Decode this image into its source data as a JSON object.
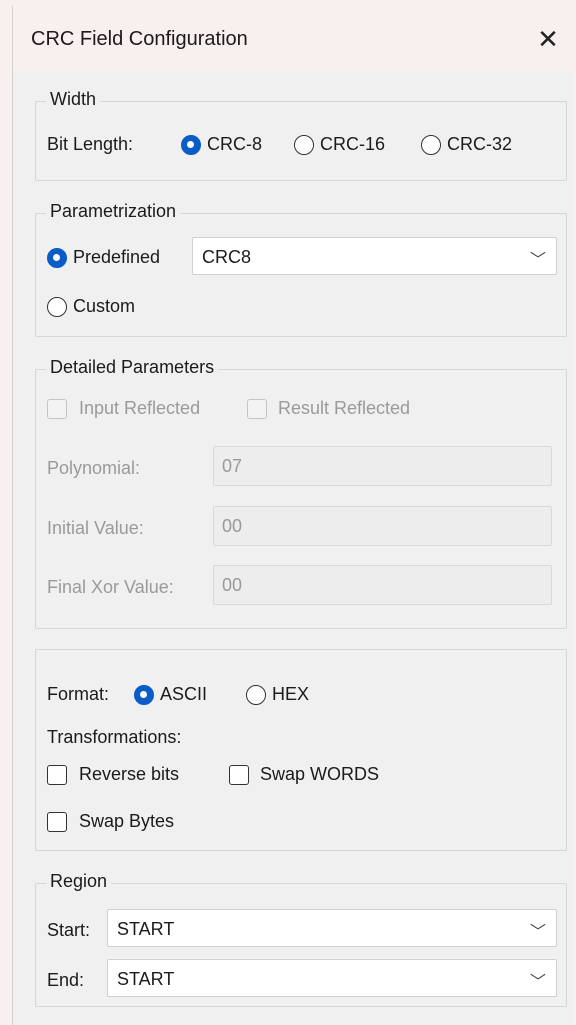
{
  "window": {
    "title": "CRC Field Configuration",
    "close_glyph": "✕"
  },
  "width": {
    "legend": "Width",
    "bit_length_label": "Bit Length:",
    "options": [
      "CRC-8",
      "CRC-16",
      "CRC-32"
    ],
    "selected": "CRC-8"
  },
  "parametrization": {
    "legend": "Parametrization",
    "predefined_label": "Predefined",
    "custom_label": "Custom",
    "selected": "Predefined",
    "predefined_value": "CRC8"
  },
  "detailed": {
    "legend": "Detailed Parameters",
    "input_reflected": "Input Reflected",
    "result_reflected": "Result Reflected",
    "polynomial_label": "Polynomial:",
    "polynomial_value": "07",
    "initial_label": "Initial Value:",
    "initial_value": "00",
    "final_label": "Final Xor Value:",
    "final_value": "00"
  },
  "format": {
    "label": "Format:",
    "options": [
      "ASCII",
      "HEX"
    ],
    "selected": "ASCII",
    "transformations_label": "Transformations:",
    "reverse_bits": "Reverse bits",
    "swap_words": "Swap WORDS",
    "swap_bytes": "Swap Bytes"
  },
  "region": {
    "legend": "Region",
    "start_label": "Start:",
    "start_value": "START",
    "end_label": "End:",
    "end_value": "START"
  },
  "colors": {
    "accent": "#0a5cc8",
    "disabled_text": "#9a9a9a",
    "window_bg": "#f0f0f0"
  }
}
